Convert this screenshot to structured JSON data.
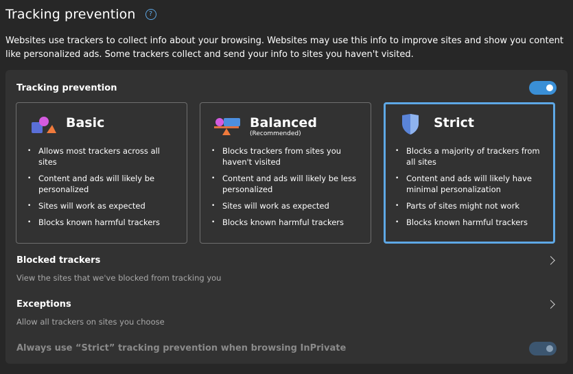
{
  "header": {
    "title": "Tracking prevention",
    "help_glyph": "?",
    "description": "Websites use trackers to collect info about your browsing. Websites may use this info to improve sites and show you content like personalized ads. Some trackers collect and send your info to sites you haven't visited."
  },
  "tracking": {
    "label": "Tracking prevention",
    "enabled": true
  },
  "cards": [
    {
      "title": "Basic",
      "subtitle": "",
      "selected": false,
      "bullets": [
        "Allows most trackers across all sites",
        "Content and ads will likely be personalized",
        "Sites will work as expected",
        "Blocks known harmful trackers"
      ]
    },
    {
      "title": "Balanced",
      "subtitle": "(Recommended)",
      "selected": false,
      "bullets": [
        "Blocks trackers from sites you haven't visited",
        "Content and ads will likely be less personalized",
        "Sites will work as expected",
        "Blocks known harmful trackers"
      ]
    },
    {
      "title": "Strict",
      "subtitle": "",
      "selected": true,
      "bullets": [
        "Blocks a majority of trackers from all sites",
        "Content and ads will likely have minimal personalization",
        "Parts of sites might not work",
        "Blocks known harmful trackers"
      ]
    }
  ],
  "blocked": {
    "title": "Blocked trackers",
    "description": "View the sites that we've blocked from tracking you"
  },
  "exceptions": {
    "title": "Exceptions",
    "description": "Allow all trackers on sites you choose"
  },
  "inprivate": {
    "label": "Always use “Strict” tracking prevention when browsing InPrivate",
    "enabled": true,
    "disabled": true
  },
  "colors": {
    "accent": "#3a8fd6",
    "selected_border": "#5ea8e6",
    "background": "#272727",
    "panel": "#323232"
  }
}
